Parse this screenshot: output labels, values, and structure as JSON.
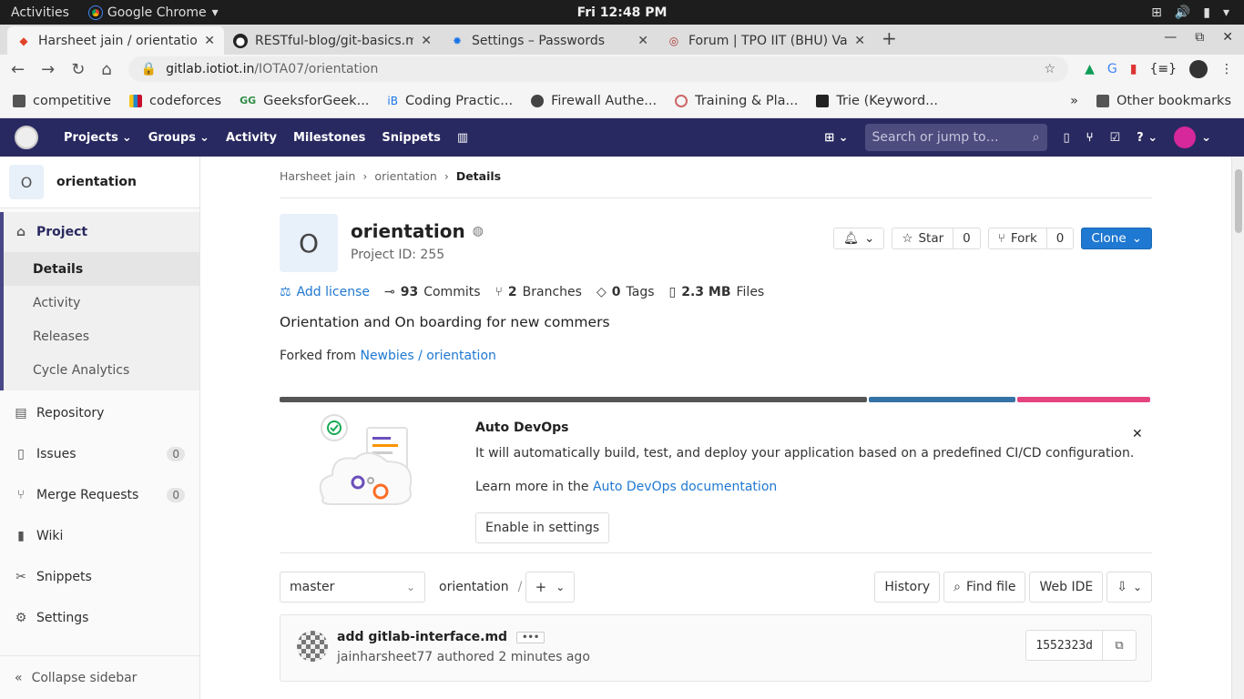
{
  "gnome": {
    "activities": "Activities",
    "app_name": "Google Chrome",
    "clock": "Fri 12:48 PM"
  },
  "browser": {
    "tabs": [
      {
        "title": "Harsheet jain / orientation",
        "icon": "gitlab-icon"
      },
      {
        "title": "RESTful-blog/git-basics.md",
        "icon": "github-icon"
      },
      {
        "title": "Settings – Passwords",
        "icon": "settings-icon"
      },
      {
        "title": "Forum | TPO IIT (BHU) Varanasi",
        "icon": "globe-icon"
      }
    ],
    "url_host": "gitlab.iotiot.in",
    "url_path": "/IOTA07/orientation",
    "bookmarks": [
      {
        "label": "competitive",
        "icon": "folder-icon"
      },
      {
        "label": "codeforces",
        "icon": "codeforces-icon"
      },
      {
        "label": "GeeksforGeek...",
        "icon": "gfg-icon"
      },
      {
        "label": "Coding Practic...",
        "icon": "ib-icon"
      },
      {
        "label": "Firewall Authe...",
        "icon": "globe-icon"
      },
      {
        "label": "Training & Pla...",
        "icon": "tpo-icon"
      },
      {
        "label": "Trie (Keyword...",
        "icon": "hackerrank-icon"
      }
    ],
    "bookmarks_more": "»",
    "other_bookmarks": "Other bookmarks"
  },
  "gitlab_nav": {
    "items": [
      "Projects",
      "Groups",
      "Activity",
      "Milestones",
      "Snippets"
    ],
    "search_placeholder": "Search or jump to…"
  },
  "sidebar": {
    "project_initial": "O",
    "project_name": "orientation",
    "project_section": "Project",
    "project_sub": [
      "Details",
      "Activity",
      "Releases",
      "Cycle Analytics"
    ],
    "items": [
      {
        "label": "Repository",
        "icon": "book-icon"
      },
      {
        "label": "Issues",
        "icon": "issues-icon",
        "count": "0"
      },
      {
        "label": "Merge Requests",
        "icon": "merge-request-icon",
        "count": "0"
      },
      {
        "label": "Wiki",
        "icon": "wiki-icon"
      },
      {
        "label": "Snippets",
        "icon": "scissors-icon"
      },
      {
        "label": "Settings",
        "icon": "gear-icon"
      }
    ],
    "collapse": "Collapse sidebar"
  },
  "breadcrumb": [
    "Harsheet jain",
    "orientation",
    "Details"
  ],
  "project": {
    "initial": "O",
    "name": "orientation",
    "id_text": "Project ID: 255",
    "star_label": "Star",
    "star_count": "0",
    "fork_label": "Fork",
    "fork_count": "0",
    "clone_label": "Clone",
    "add_license": "Add license",
    "commits_num": "93",
    "commits_label": "Commits",
    "branches_num": "2",
    "branches_label": "Branches",
    "tags_num": "0",
    "tags_label": "Tags",
    "files_num": "2.3 MB",
    "files_label": "Files",
    "description": "Orientation and On boarding for new commers",
    "forked_prefix": "Forked from",
    "forked_link": "Newbies / orientation"
  },
  "language_bar": {
    "segments": [
      {
        "fraction": 0.675,
        "color": "#555555"
      },
      {
        "fraction": 0.17,
        "color": "#3572a5"
      },
      {
        "fraction": 0.155,
        "color": "#e4457e"
      }
    ]
  },
  "devops": {
    "title": "Auto DevOps",
    "text": "It will automatically build, test, and deploy your application based on a predefined CI/CD configuration.",
    "learn_prefix": "Learn more in the",
    "learn_link": "Auto DevOps documentation",
    "enable": "Enable in settings"
  },
  "repo": {
    "branch": "master",
    "path": "orientation",
    "separator": "/",
    "history": "History",
    "find_file": "Find file",
    "web_ide": "Web IDE"
  },
  "commit": {
    "title": "add gitlab-interface.md",
    "author": "jainharsheet77",
    "meta_suffix": "authored 2 minutes ago",
    "sha": "1552323d"
  },
  "colors": {
    "gitlab_nav": "#292961",
    "accent_blue": "#1f78d1"
  }
}
